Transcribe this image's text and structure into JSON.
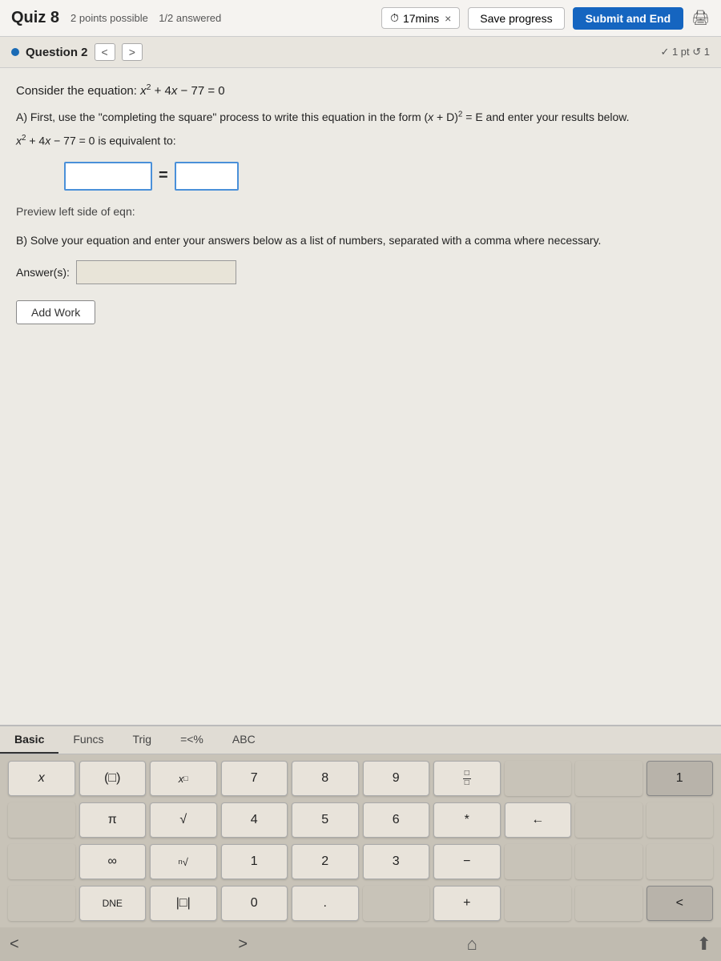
{
  "header": {
    "title": "Quiz 8",
    "points": "2 points possible",
    "progress": "1/2 answered",
    "timer": "17mins",
    "timer_x": "×",
    "save_label": "Save progress",
    "submit_label": "Submit and End"
  },
  "question_nav": {
    "label": "Question 2",
    "prev": "<",
    "next": ">",
    "score_display": "✓ 1 pt  ↺ 1"
  },
  "question": {
    "equation_text": "Consider the equation: x² + 4x − 77 = 0",
    "part_a": "A) First, use the \"completing the square\" process to write this equation in the form (x + D)² = E and enter your results below.",
    "equiv_text": "x² + 4x − 77 = 0 is equivalent to:",
    "preview_label": "Preview left side of eqn:",
    "part_b": "B) Solve your equation and enter your answers below as a list of numbers, separated with a comma where necessary.",
    "answer_label": "Answer(s):",
    "add_work": "Add Work"
  },
  "keyboard": {
    "tabs": [
      "Basic",
      "Funcs",
      "Trig",
      "=<%",
      "ABC"
    ],
    "active_tab": "Basic",
    "keys": [
      {
        "label": "x",
        "type": "normal"
      },
      {
        "label": "(□)",
        "type": "normal"
      },
      {
        "label": "x□",
        "type": "superscript"
      },
      {
        "label": "7",
        "type": "normal"
      },
      {
        "label": "8",
        "type": "normal"
      },
      {
        "label": "9",
        "type": "normal"
      },
      {
        "label": "fraction",
        "type": "fraction"
      },
      {
        "label": "",
        "type": "empty"
      },
      {
        "label": "1",
        "type": "last-row-placeholder"
      },
      {
        "label": "",
        "type": "empty"
      },
      {
        "label": "π",
        "type": "normal"
      },
      {
        "label": "√",
        "type": "normal"
      },
      {
        "label": "4",
        "type": "normal"
      },
      {
        "label": "5",
        "type": "normal"
      },
      {
        "label": "6",
        "type": "normal"
      },
      {
        "label": "*",
        "type": "normal"
      },
      {
        "label": "←",
        "type": "normal"
      },
      {
        "label": "",
        "type": "empty"
      },
      {
        "label": "∞",
        "type": "normal"
      },
      {
        "label": "ⁿ√",
        "type": "normal"
      },
      {
        "label": "1",
        "type": "normal"
      },
      {
        "label": "2",
        "type": "normal"
      },
      {
        "label": "3",
        "type": "normal"
      },
      {
        "label": "-",
        "type": "normal"
      },
      {
        "label": "",
        "type": "empty"
      },
      {
        "label": "",
        "type": "empty"
      },
      {
        "label": "DNE",
        "type": "normal"
      },
      {
        "label": "|□|",
        "type": "normal"
      },
      {
        "label": "0",
        "type": "normal"
      },
      {
        "label": ".",
        "type": "normal"
      },
      {
        "label": "",
        "type": "empty"
      },
      {
        "label": "+",
        "type": "normal"
      },
      {
        "label": "",
        "type": "empty"
      },
      {
        "label": "<",
        "type": "arrow"
      }
    ]
  }
}
